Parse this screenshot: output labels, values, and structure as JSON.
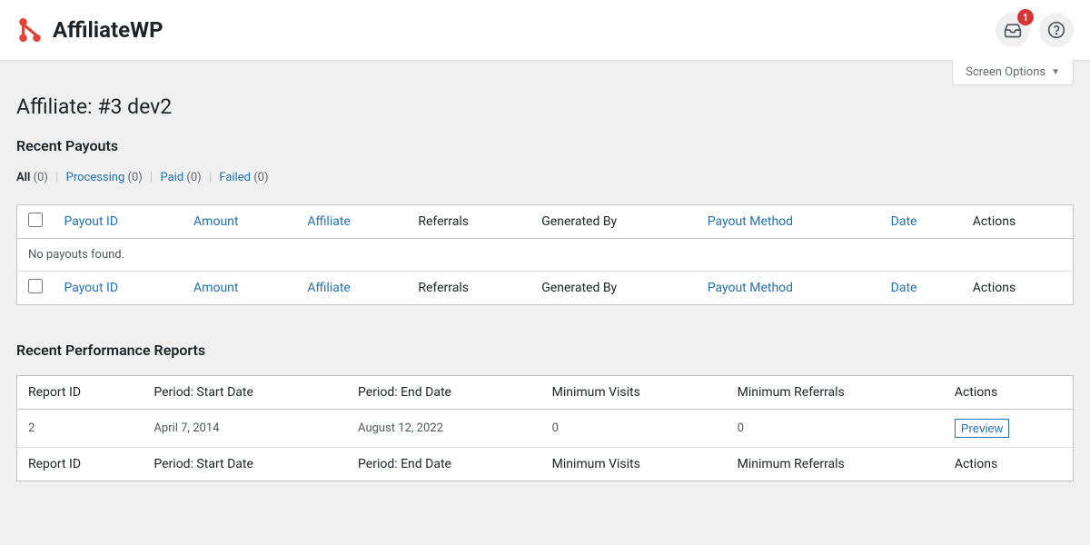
{
  "brand": {
    "name": "AffiliateWP",
    "badge_count": "1"
  },
  "screen_options_label": "Screen Options",
  "page_title": "Affiliate: #3 dev2",
  "payouts": {
    "title": "Recent Payouts",
    "filters": {
      "all_label": "All",
      "all_count": "(0)",
      "processing_label": "Processing",
      "processing_count": "(0)",
      "paid_label": "Paid",
      "paid_count": "(0)",
      "failed_label": "Failed",
      "failed_count": "(0)"
    },
    "headers": {
      "payout_id": "Payout ID",
      "amount": "Amount",
      "affiliate": "Affiliate",
      "referrals": "Referrals",
      "generated_by": "Generated By",
      "payout_method": "Payout Method",
      "date": "Date",
      "actions": "Actions"
    },
    "empty_message": "No payouts found."
  },
  "reports": {
    "title": "Recent Performance Reports",
    "headers": {
      "report_id": "Report ID",
      "start_date": "Period: Start Date",
      "end_date": "Period: End Date",
      "min_visits": "Minimum Visits",
      "min_referrals": "Minimum Referrals",
      "actions": "Actions"
    },
    "rows": [
      {
        "id": "2",
        "start": "April 7, 2014",
        "end": "August 12, 2022",
        "visits": "0",
        "referrals": "0",
        "action_label": "Preview"
      }
    ]
  }
}
